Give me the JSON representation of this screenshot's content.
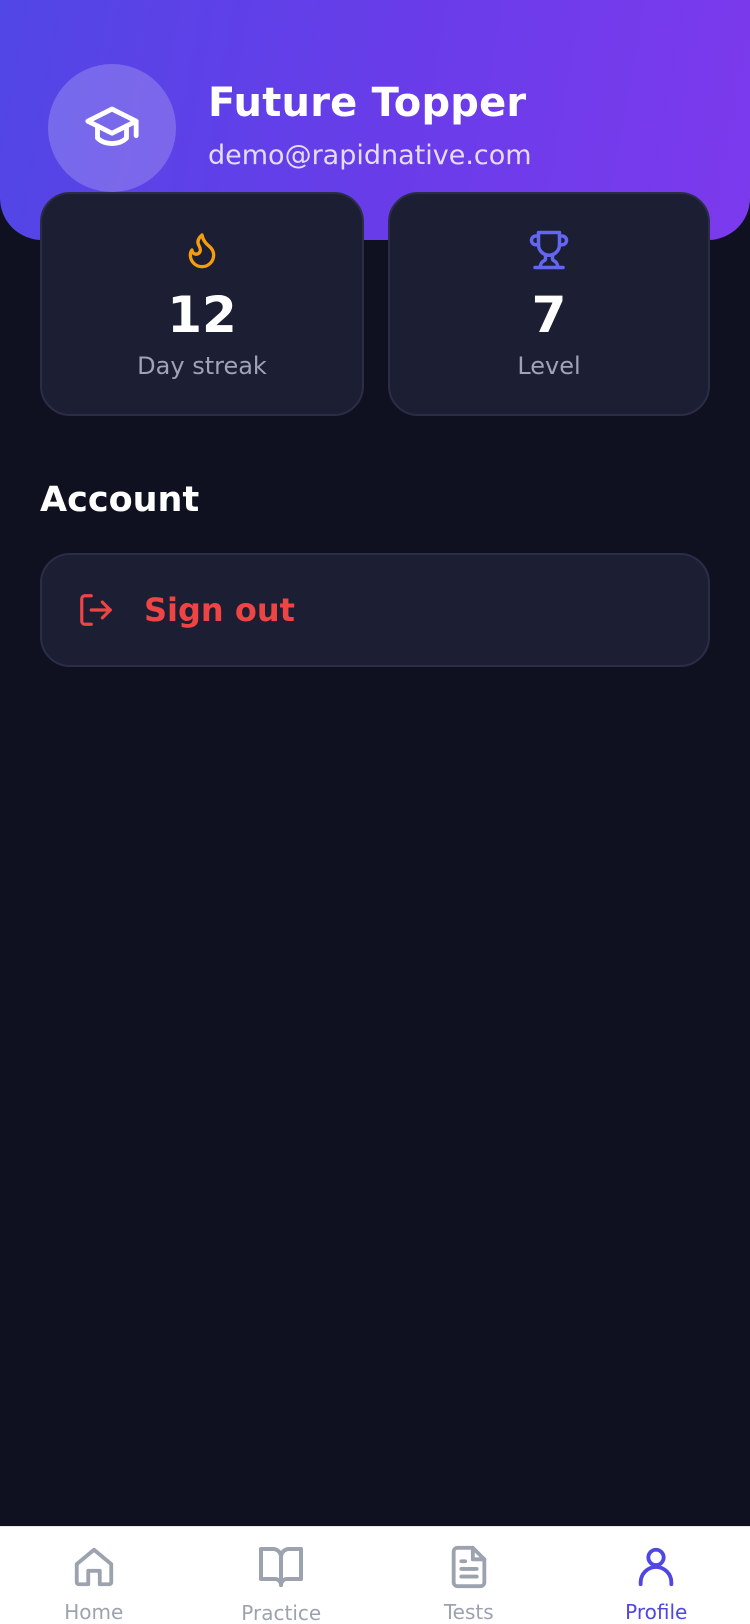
{
  "profile": {
    "name": "Future Topper",
    "email": "demo@rapidnative.com",
    "avatar_icon": "graduation-cap-icon"
  },
  "stats": [
    {
      "value": "12",
      "label": "Day streak",
      "icon": "flame-icon",
      "color": "#f59e0b"
    },
    {
      "value": "7",
      "label": "Level",
      "icon": "trophy-icon",
      "color": "#6366f1"
    }
  ],
  "account": {
    "title": "Account",
    "signout_label": "Sign out",
    "signout_icon": "log-out-icon",
    "signout_color": "#ef4444"
  },
  "tabs": [
    {
      "label": "Home",
      "icon": "home-icon",
      "active": false
    },
    {
      "label": "Practice",
      "icon": "book-open-icon",
      "active": false
    },
    {
      "label": "Tests",
      "icon": "file-text-icon",
      "active": false
    },
    {
      "label": "Profile",
      "icon": "user-icon",
      "active": true
    }
  ],
  "colors": {
    "accent": "#4f46e5",
    "background": "#0f1120",
    "card": "#1c1e33",
    "tab_inactive": "#9ca3af"
  }
}
